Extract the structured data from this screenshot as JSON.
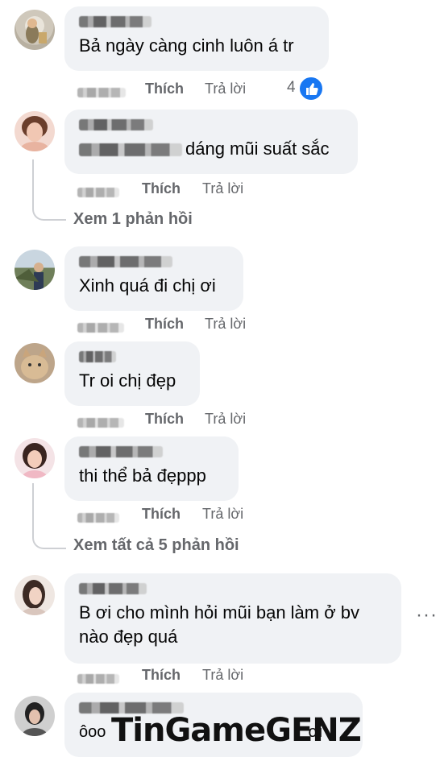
{
  "comments": [
    {
      "text": "Bả ngày càng cinh luôn á tr",
      "like_label": "Thích",
      "reply_label": "Trả lời",
      "reaction_count": "4"
    },
    {
      "text": "dáng mũi suất sắc",
      "like_label": "Thích",
      "reply_label": "Trả lời",
      "replies_label": "Xem 1 phản hồi"
    },
    {
      "text": "Xinh quá đi chị ơi",
      "like_label": "Thích",
      "reply_label": "Trả lời"
    },
    {
      "text": "Tr oi chị đẹp",
      "like_label": "Thích",
      "reply_label": "Trả lời"
    },
    {
      "text": "thi thể bả đẹppp",
      "like_label": "Thích",
      "reply_label": "Trả lời",
      "replies_label": "Xem tất cả 5 phản hồi"
    },
    {
      "text_line1": "B ơi cho mình hỏi mũi bạn làm ở bv",
      "text_line2": "nào đẹp quá",
      "like_label": "Thích",
      "reply_label": "Trả lời",
      "more_label": "···"
    },
    {
      "text": "ơi",
      "text_prefix": "ôoo"
    }
  ],
  "watermark": "TinGameGENZ",
  "colors": {
    "bubble": "#f0f2f5",
    "meta": "#65676b",
    "like_blue": "#1877f2"
  }
}
